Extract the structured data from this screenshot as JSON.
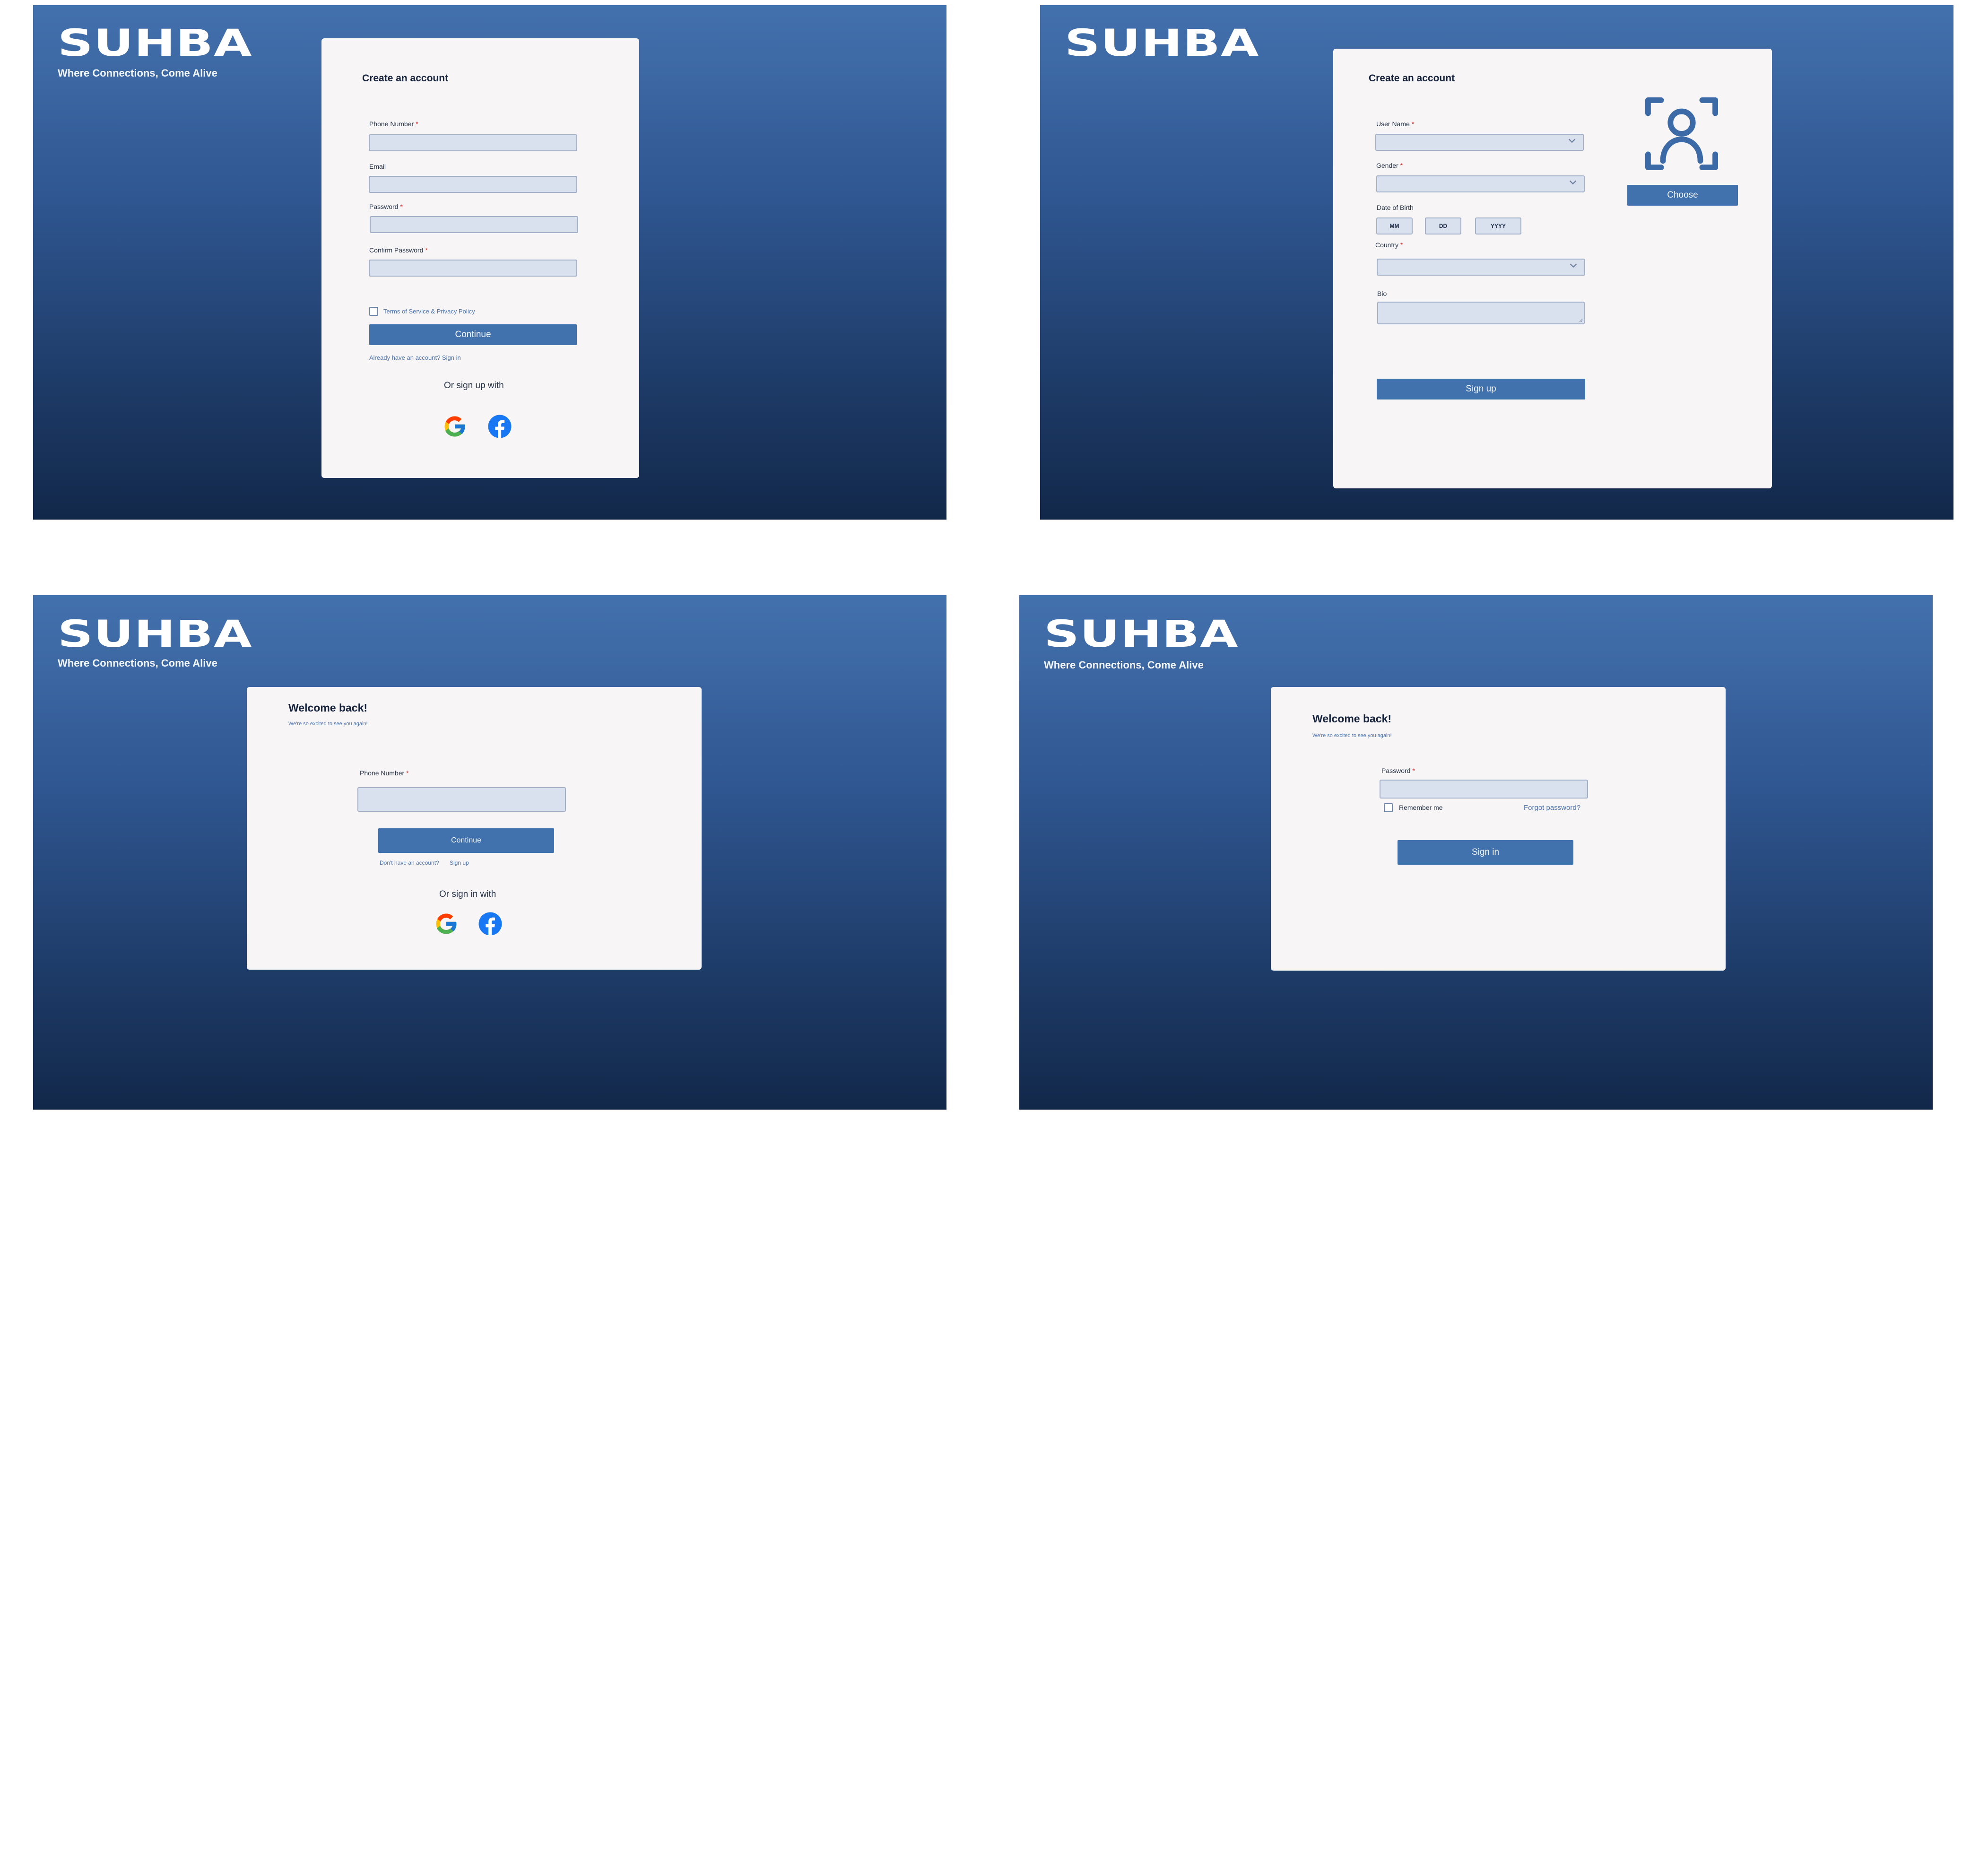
{
  "brand": {
    "logo": "SUHBA",
    "tagline": "Where Connections, Come Alive"
  },
  "signup_step1": {
    "title": "Create an account",
    "phone_label": "Phone Number",
    "email_label": "Email",
    "password_label": "Password",
    "confirm_label": "Confirm Password",
    "required_mark": "*",
    "terms_label": "Terms of Service & Privacy Policy",
    "continue_label": "Continue",
    "signin_link": "Already have an account? Sign in",
    "or_label": "Or sign up with"
  },
  "signup_step2": {
    "title": "Create an account",
    "username_label": "User Name",
    "gender_label": "Gender",
    "dob_label": "Date of Birth",
    "dob_mm": "MM",
    "dob_dd": "DD",
    "dob_yyyy": "YYYY",
    "country_label": "Country",
    "bio_label": "Bio",
    "choose_label": "Choose",
    "signup_label": "Sign up"
  },
  "login_phone": {
    "title": "Welcome back!",
    "subtitle": "We're so excited to see you again!",
    "phone_label": "Phone Number",
    "continue_label": "Continue",
    "no_account": "Don't have an account?",
    "signup_link": "Sign up",
    "or_label": "Or sign in with"
  },
  "login_password": {
    "title": "Welcome back!",
    "subtitle": "We're so excited to see you again!",
    "password_label": "Password",
    "remember_label": "Remember me",
    "forgot_link": "Forgot password?",
    "signin_label": "Sign in"
  },
  "colors": {
    "accent": "#4272ad",
    "card": "#f7f5f5",
    "field": "#d9e1ee",
    "required": "#d0342c",
    "link": "#4d76b1"
  },
  "icons": [
    "google-icon",
    "facebook-icon",
    "chevron-down-icon",
    "user-avatar-icon",
    "checkbox-icon",
    "resize-handle-icon"
  ]
}
